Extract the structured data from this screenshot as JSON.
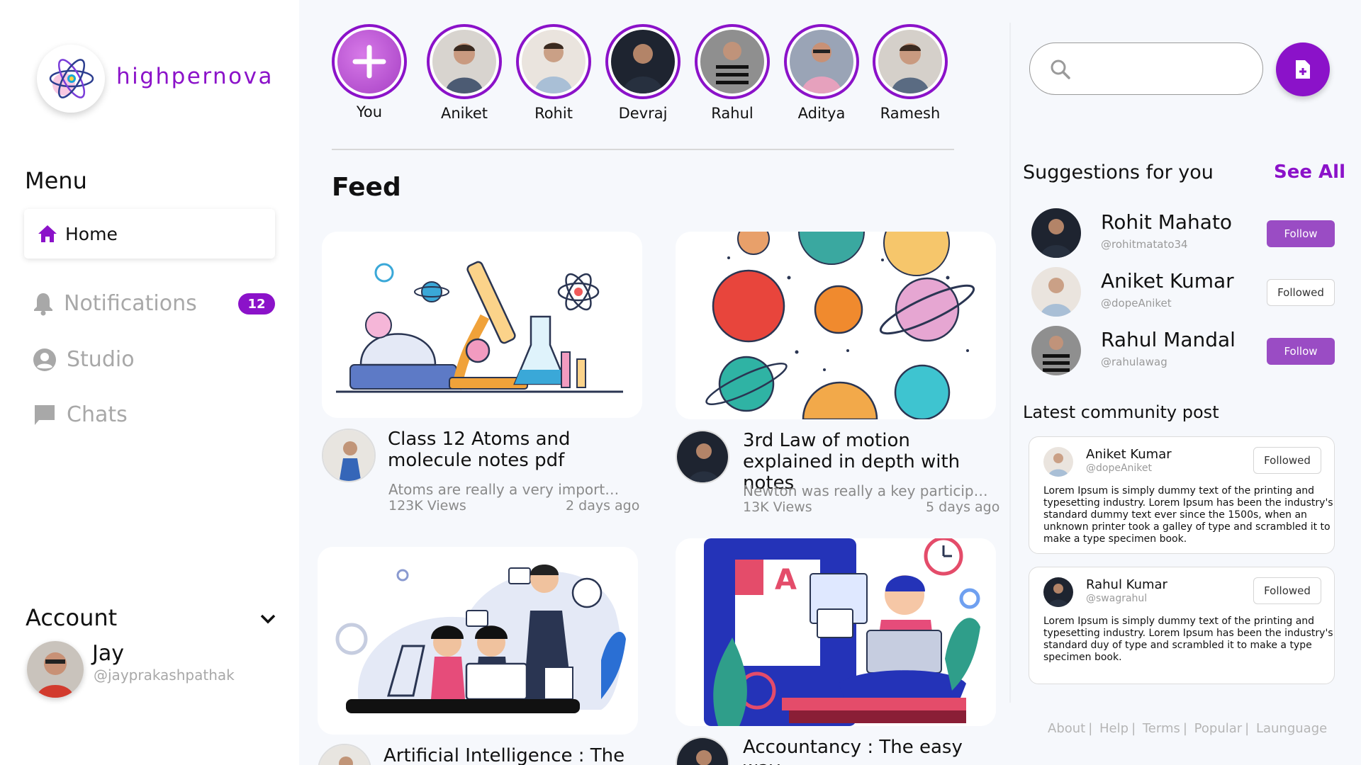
{
  "brand": {
    "name": "highpernova",
    "logo_icon": "atom-icon"
  },
  "sidebar": {
    "menu_title": "Menu",
    "items": [
      {
        "label": "Home",
        "icon": "home-icon",
        "active": true
      },
      {
        "label": "Notifications",
        "icon": "bell-icon",
        "badge": "12"
      },
      {
        "label": "Studio",
        "icon": "user-circle-icon"
      },
      {
        "label": "Chats",
        "icon": "chat-icon"
      }
    ],
    "account": {
      "title": "Account",
      "name": "Jay",
      "handle": "@jayprakashpathak"
    }
  },
  "stories": [
    {
      "name": "You",
      "add": true
    },
    {
      "name": "Aniket"
    },
    {
      "name": "Rohit"
    },
    {
      "name": "Devraj"
    },
    {
      "name": "Rahul"
    },
    {
      "name": "Aditya"
    },
    {
      "name": "Ramesh"
    }
  ],
  "feed": {
    "title": "Feed",
    "posts": [
      {
        "title": "Class 12 Atoms and molecule notes pdf",
        "desc": "Atoms are really a very important part of chemistry",
        "views": "123K Views",
        "age": "2 days ago"
      },
      {
        "title": "3rd Law of motion explained in depth with notes",
        "desc": "Newton was really a key participant in physics",
        "views": "13K Views",
        "age": "5 days ago"
      },
      {
        "title": "Artificial Intelligence : The",
        "desc": "",
        "views": "",
        "age": ""
      },
      {
        "title": "Accountancy : The easy way",
        "desc": "",
        "views": "",
        "age": ""
      }
    ]
  },
  "suggestions": {
    "title": "Suggestions for you",
    "see_all": "See All",
    "users": [
      {
        "name": "Rohit Mahato",
        "handle": "@rohitmatato34",
        "action": "Follow"
      },
      {
        "name": "Aniket Kumar",
        "handle": "@dopeAniket",
        "action": "Followed"
      },
      {
        "name": "Rahul Mandal",
        "handle": "@rahulawag",
        "action": "Follow"
      }
    ]
  },
  "community": {
    "title": "Latest community post",
    "posts": [
      {
        "name": "Aniket Kumar",
        "handle": "@dopeAniket",
        "action": "Followed",
        "text": "Lorem Ipsum is simply dummy text of the printing and typesetting industry. Lorem Ipsum has been the industry's standard dummy text ever since the 1500s, when an unknown printer took a galley of type and scrambled it to make a type specimen book."
      },
      {
        "name": "Rahul Kumar",
        "handle": "@swagrahul",
        "action": "Followed",
        "text": "Lorem Ipsum is simply dummy text of the printing and typesetting industry. Lorem Ipsum has been the industry's standard duy of type and scrambled it to make a type specimen book."
      }
    ]
  },
  "footer": {
    "links": [
      "About",
      "Help",
      "Terms",
      "Popular",
      "Launguage"
    ]
  },
  "colors": {
    "accent": "#8b12c9",
    "follow_button": "#9a4cc4",
    "muted": "#a8a8a8"
  }
}
